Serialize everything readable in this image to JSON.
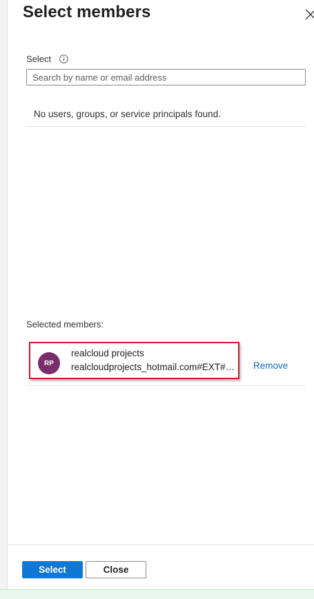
{
  "panel": {
    "title": "Select members"
  },
  "select_section": {
    "label": "Select",
    "search_placeholder": "Search by name or email address",
    "search_value": "",
    "empty_message": "No users, groups, or service principals found."
  },
  "selected_members": {
    "label": "Selected members:",
    "items": [
      {
        "initials": "RP",
        "name": "realcloud projects",
        "email": "realcloudprojects_hotmail.com#EXT#@realcloudprojectshotmail.onmicrosoft.com",
        "remove_label": "Remove",
        "avatar_color": "#7a2d6b"
      }
    ]
  },
  "footer": {
    "select_label": "Select",
    "close_label": "Close"
  },
  "colors": {
    "primary": "#0f78d4",
    "link": "#0f6cbd",
    "highlight": "#d1162a"
  },
  "icons": {
    "close": "close-icon",
    "info": "info-icon"
  }
}
